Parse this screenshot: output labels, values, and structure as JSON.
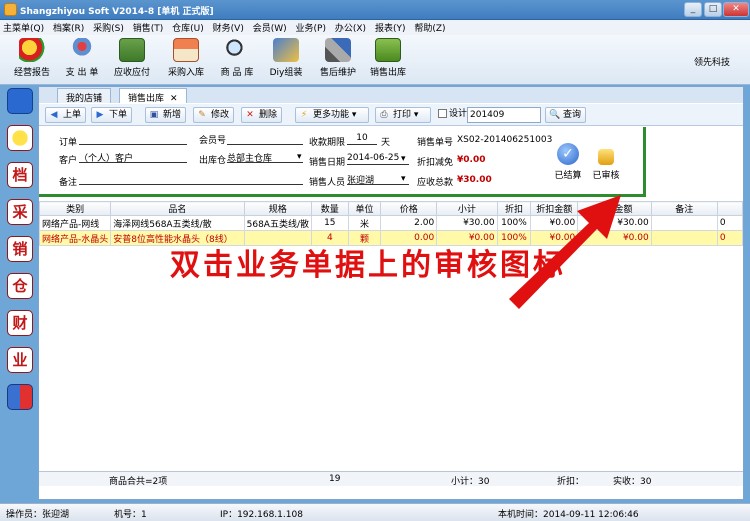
{
  "window": {
    "title": "Shangzhiyou Soft V2014-8 [单机 正式版]",
    "minimize": "_",
    "maximize": "□",
    "close": "✕"
  },
  "menu": [
    "主菜单(Q)",
    "档案(R)",
    "采购(S)",
    "销售(T)",
    "仓库(U)",
    "财务(V)",
    "会员(W)",
    "业务(P)",
    "办公(X)",
    "报表(Y)",
    "帮助(Z)"
  ],
  "toolbar": {
    "items": [
      "经营报告",
      "支 出 单",
      "应收应付",
      "采购入库",
      "商 品 库",
      "Diy组装",
      "售后维护",
      "销售出库"
    ],
    "icon_names": [
      "pie-chart-icon",
      "person-pin-icon",
      "calculator-icon",
      "house-icon",
      "magnifier-icon",
      "assembly-icon",
      "tools-icon",
      "sales-out-icon"
    ],
    "brand": "领先科技"
  },
  "leftbar": {
    "items": [
      "",
      "",
      "档",
      "采",
      "销",
      "仓",
      "财",
      "业",
      ""
    ],
    "icon_names": [
      "flag-icon",
      "bulb-icon",
      "archive-icon",
      "purchase-icon",
      "sales-icon",
      "warehouse-icon",
      "finance-icon",
      "business-icon",
      "exit-icon"
    ]
  },
  "tabs": [
    {
      "label": "我的店铺"
    },
    {
      "label": "销售出库",
      "close": "✕"
    }
  ],
  "actions": {
    "prev": "上单",
    "next": "下单",
    "new": "新增",
    "edit": "修改",
    "delete": "删除",
    "more": "更多功能",
    "print": "打印",
    "design": "设计",
    "period": "201409",
    "query": "查询"
  },
  "form": {
    "order_label": "订单",
    "order_value": "",
    "member_label": "会员号",
    "member_value": "",
    "days_label": "收款期限",
    "days_value": "10",
    "days_unit": "天",
    "doc_label": "销售单号",
    "doc_value": "XS02-201406251003",
    "customer_label": "客户",
    "customer_value": "（个人）客户",
    "warehouse_label": "出库仓",
    "warehouse_value": "总部主仓库",
    "date_label": "销售日期",
    "date_value": "2014-06-25",
    "discount_label": "折扣减免",
    "discount_value": "¥0.00",
    "note_label": "备注",
    "note_value": "",
    "seller_label": "销售人员",
    "seller_value": "张迎湖",
    "total_label": "应收总款",
    "total_value": "¥30.00",
    "settled_label": "已结算",
    "audited_label": "已审核"
  },
  "table": {
    "headers": [
      "类别",
      "品名",
      "规格",
      "数量",
      "单位",
      "价格",
      "小计",
      "折扣",
      "折扣金额",
      "实收金额",
      "备注",
      ""
    ],
    "rows": [
      [
        "网络产品-网线",
        "海泽网线568A五类线/散",
        "568A五类线/散",
        "15",
        "米",
        "2.00",
        "¥30.00",
        "100%",
        "¥0.00",
        "¥30.00",
        "",
        "0"
      ],
      [
        "网络产品-水晶头",
        "安普8位高性能水晶头（8线）",
        "",
        "4",
        "颗",
        "0.00",
        "¥0.00",
        "100%",
        "¥0.00",
        "¥0.00",
        "",
        "0"
      ]
    ]
  },
  "annotation": "双击业务单据上的审核图标",
  "summary": {
    "items": "商品合共=2项",
    "qty": "19",
    "subtotal": "小计：30",
    "discount": "折扣：",
    "received": "实收：30"
  },
  "status": {
    "operator": "操作员：张迎湖",
    "machine": "机号：1",
    "ip": "IP：192.168.1.108",
    "time": "本机时间：2014-09-11 12:06:46"
  }
}
